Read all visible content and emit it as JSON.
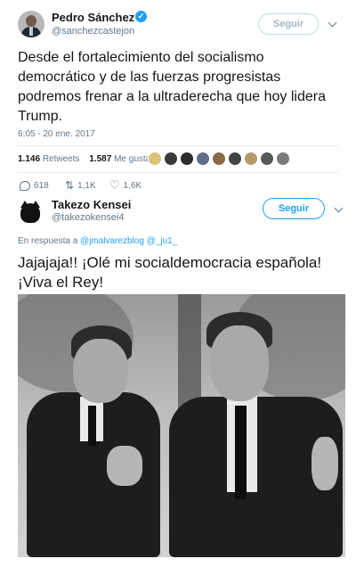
{
  "tweet": {
    "author_name": "Pedro Sánchez",
    "author_handle": "@sanchezcastejon",
    "follow_label": "Seguir",
    "text": "Desde el fortalecimiento del socialismo democrático y de las fuerzas progresistas podremos frenar a la ultraderecha que hoy lidera Trump.",
    "timestamp": "6:05 - 20 ene. 2017",
    "retweets_count": "1.146",
    "retweets_label": "Retweets",
    "likes_count": "1.587",
    "likes_label": "Me gusta",
    "replies": "618",
    "retweets_short": "1,1K",
    "likes_short": "1,6K"
  },
  "reply": {
    "author_name": "Takezo Kensei",
    "author_handle": "@takezokensei4",
    "follow_label": "Seguir",
    "reply_prefix": "En respuesta a",
    "reply_to": "@jmalvarezblog @_ju1_",
    "text": "Jajajaja!! ¡Olé mi socialdemocracia española! ¡Viva el Rey!"
  },
  "colors": {
    "accent": "#1da1f2",
    "muted": "#657786"
  },
  "icons": [
    "verified-icon",
    "chevron-down-icon",
    "reply-icon",
    "retweet-icon",
    "like-icon"
  ]
}
